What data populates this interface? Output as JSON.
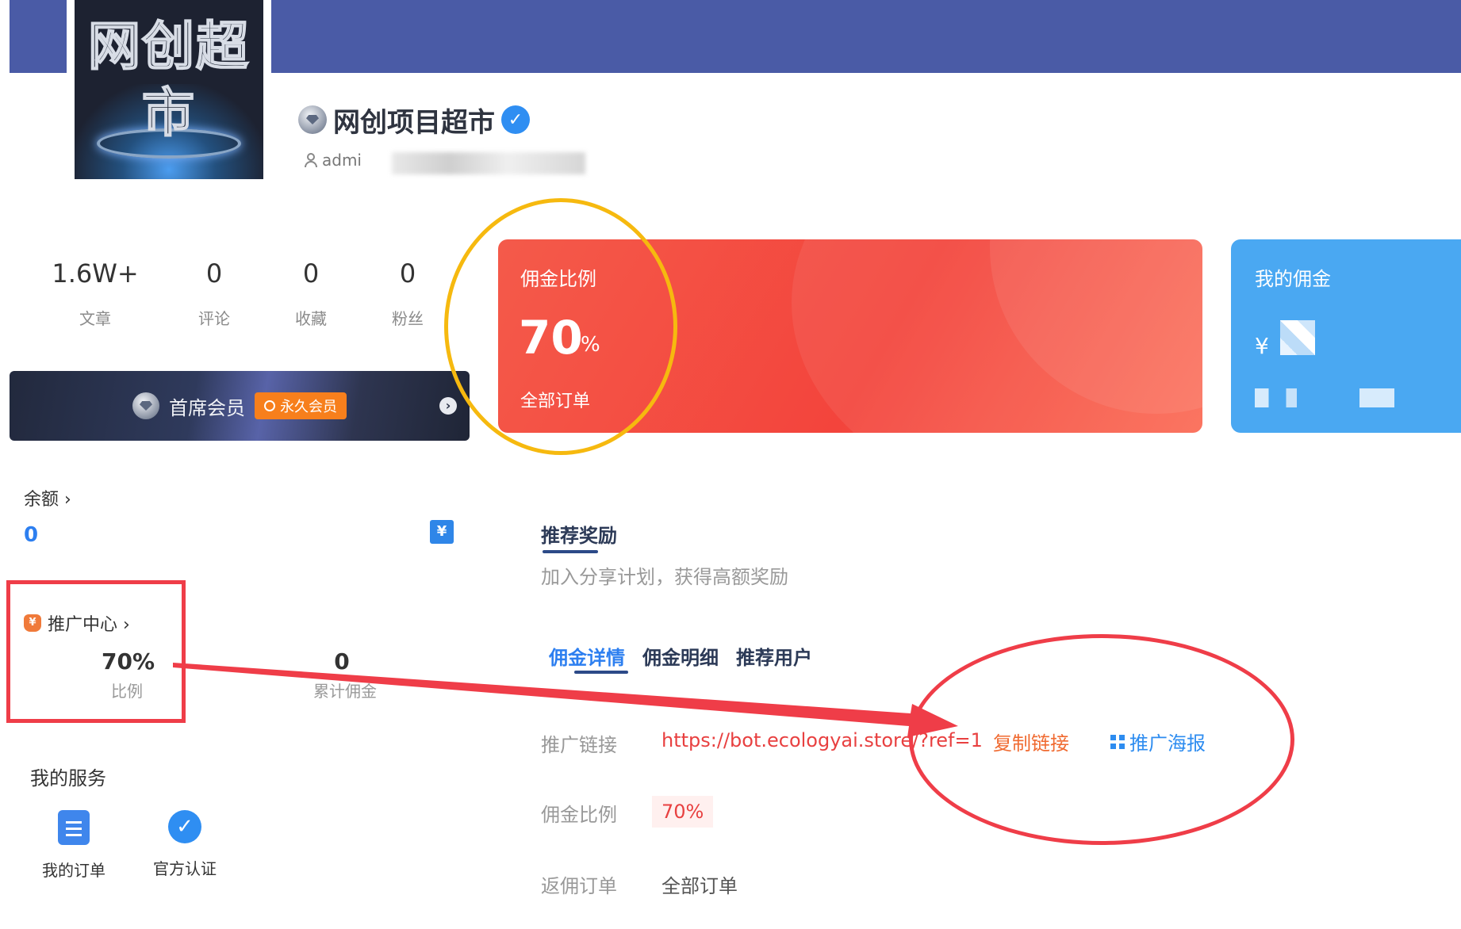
{
  "profile": {
    "avatar_text": "网创超市",
    "name": "网创项目超市",
    "username": "admi"
  },
  "stats": [
    {
      "value": "1.6W+",
      "label": "文章"
    },
    {
      "value": "0",
      "label": "评论"
    },
    {
      "value": "0",
      "label": "收藏"
    },
    {
      "value": "0",
      "label": "粉丝"
    }
  ],
  "vip": {
    "label": "首席会员",
    "badge": "永久会员"
  },
  "commission_card": {
    "title": "佣金比例",
    "value": "70",
    "unit": "%",
    "footer": "全部订单",
    "colors": {
      "card": "#f3443c",
      "annotation_ring": "#f6b90f"
    }
  },
  "my_commission_card": {
    "title": "我的佣金",
    "currency": "¥",
    "color": "#4aa8f2"
  },
  "balance": {
    "label": "余额 ›",
    "value": "0",
    "icon": "wallet-icon"
  },
  "promotion_center": {
    "label": "推广中心 ›",
    "rate_value": "70%",
    "rate_label": "比例",
    "cumulative_value": "0",
    "cumulative_label": "累计佣金"
  },
  "services": {
    "title": "我的服务",
    "items": [
      {
        "label": "我的订单",
        "icon": "order-icon"
      },
      {
        "label": "官方认证",
        "icon": "verified-icon"
      }
    ]
  },
  "rewards": {
    "title": "推荐奖励",
    "subtitle": "加入分享计划，获得高额奖励",
    "tabs": [
      "佣金详情",
      "佣金明细",
      "推荐用户"
    ],
    "rows": {
      "link_label": "推广链接",
      "link_value": "https://bot.ecologyai.store/?ref=1",
      "copy_label": "复制链接",
      "poster_label": "推广海报",
      "rate_label": "佣金比例",
      "rate_value": "70%",
      "orders_label": "返佣订单",
      "orders_value": "全部订单"
    }
  },
  "colors": {
    "banner": "#4a5ba6",
    "accent_blue": "#2d7ff0",
    "accent_red": "#e84040",
    "annotation_red": "#ef3d48"
  }
}
